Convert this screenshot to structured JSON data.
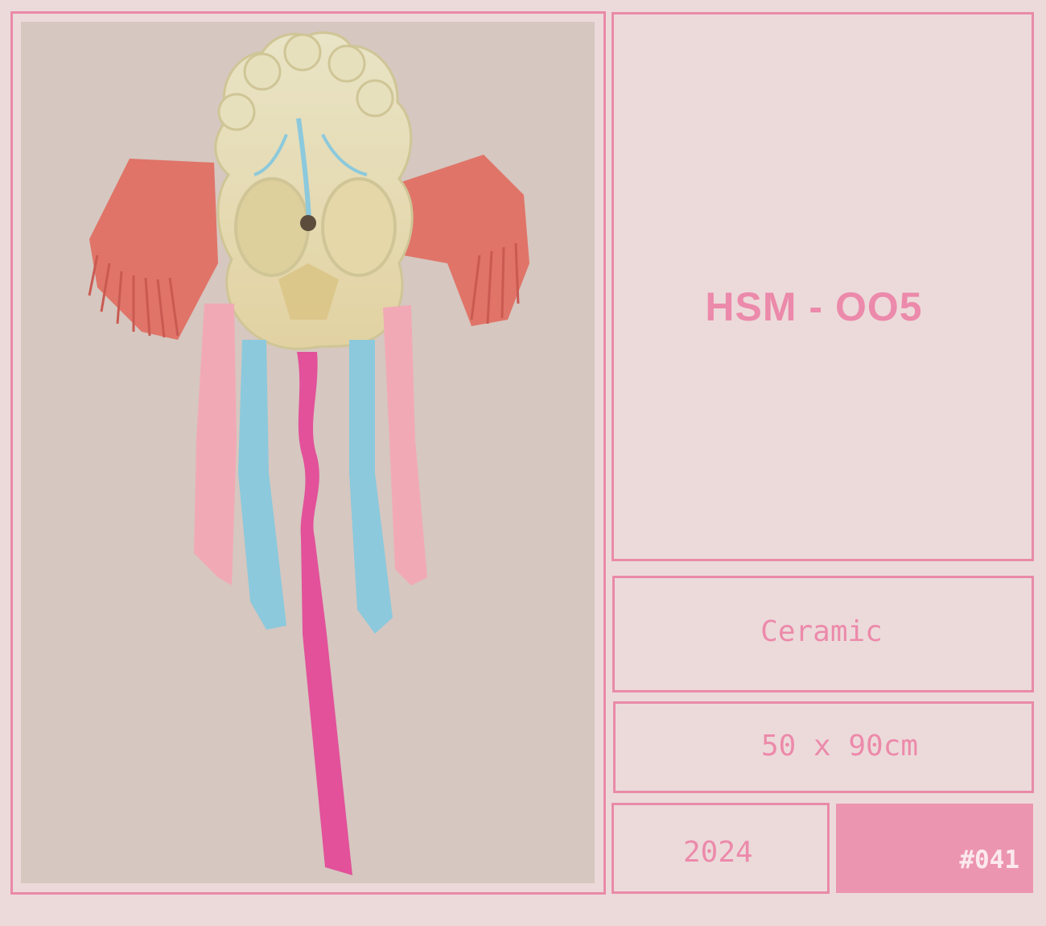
{
  "artwork": {
    "image_subject": "ceramic-macrame-wall-hanging",
    "colors": {
      "background": "#ecdada",
      "accent": "#e98aa8",
      "photo_background": "#d6c7c0",
      "coral": "#e07468",
      "light_pink": "#f2a9b6",
      "sky_blue": "#8cc9dc",
      "magenta": "#e2519a",
      "ceramic": "#e4dcb6"
    }
  },
  "details": {
    "title": "HSM - OO5",
    "material": "Ceramic",
    "dimensions": "50 x 90cm",
    "year": "2024",
    "number": "#041"
  }
}
